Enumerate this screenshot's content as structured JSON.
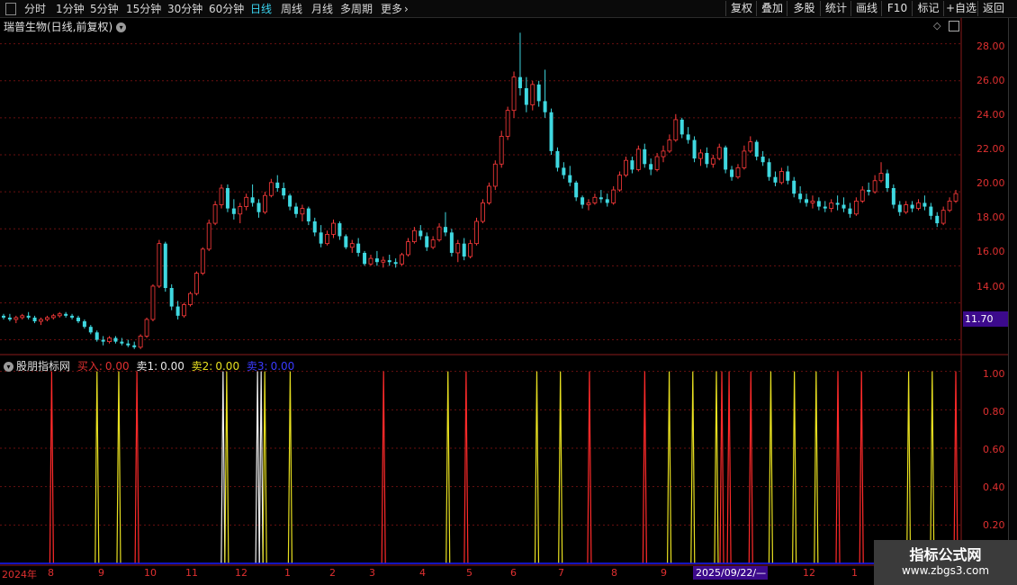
{
  "toolbar": {
    "periods": [
      "分时",
      "1分钟",
      "5分钟",
      "15分钟",
      "30分钟",
      "60分钟",
      "日线",
      "周线",
      "月线",
      "多周期",
      "更多"
    ],
    "active_period": "日线",
    "more_arrow": "›",
    "right_buttons": [
      "复权",
      "叠加",
      "多股",
      "统计",
      "画线",
      "F10",
      "标记",
      "+自选",
      "返回"
    ]
  },
  "main": {
    "title": "瑞普生物(日线,前复权)",
    "price_ticks": [
      "28.00",
      "26.00",
      "24.00",
      "22.00",
      "20.00",
      "18.00",
      "16.00",
      "14.00"
    ],
    "current_price": "11.70"
  },
  "indicator": {
    "name": "股朋指标网",
    "buy_label": "买入:",
    "buy_value": "0.00",
    "sell1_label": "卖1:",
    "sell1_value": "0.00",
    "sell2_label": "卖2:",
    "sell2_value": "0.00",
    "sell3_label": "卖3:",
    "sell3_value": "0.00",
    "ticks": [
      "1.00",
      "0.80",
      "0.60",
      "0.40",
      "0.20"
    ]
  },
  "date_axis": {
    "labels": [
      "2024年",
      "8",
      "9",
      "10",
      "11",
      "12",
      "1",
      "2",
      "3",
      "4",
      "5",
      "6",
      "7",
      "8",
      "9",
      "12",
      "1"
    ],
    "highlight": "2025/09/22/—"
  },
  "watermark": {
    "title": "指标公式网",
    "url": "www.zbgs3.com"
  },
  "chart_data": {
    "type": "candlestick",
    "ylim": [
      11.2,
      29.2
    ],
    "candles": [
      [
        13.3,
        13.4,
        13.1,
        13.2
      ],
      [
        13.2,
        13.4,
        13.0,
        13.1
      ],
      [
        13.1,
        13.3,
        12.9,
        13.2
      ],
      [
        13.2,
        13.4,
        13.1,
        13.3
      ],
      [
        13.3,
        13.5,
        13.1,
        13.2
      ],
      [
        13.2,
        13.3,
        12.9,
        13.0
      ],
      [
        13.0,
        13.2,
        12.8,
        13.1
      ],
      [
        13.1,
        13.3,
        13.0,
        13.2
      ],
      [
        13.2,
        13.4,
        13.1,
        13.3
      ],
      [
        13.3,
        13.5,
        13.2,
        13.4
      ],
      [
        13.4,
        13.5,
        13.2,
        13.3
      ],
      [
        13.3,
        13.4,
        13.1,
        13.2
      ],
      [
        13.2,
        13.3,
        12.9,
        13.0
      ],
      [
        13.0,
        13.1,
        12.6,
        12.7
      ],
      [
        12.7,
        12.8,
        12.3,
        12.4
      ],
      [
        12.4,
        12.5,
        11.9,
        12.0
      ],
      [
        12.0,
        12.2,
        11.7,
        11.9
      ],
      [
        11.9,
        12.2,
        11.8,
        12.1
      ],
      [
        12.1,
        12.2,
        11.8,
        11.9
      ],
      [
        11.9,
        12.1,
        11.7,
        11.8
      ],
      [
        11.8,
        12.0,
        11.6,
        11.7
      ],
      [
        11.7,
        11.9,
        11.5,
        11.6
      ],
      [
        11.6,
        12.3,
        11.5,
        12.2
      ],
      [
        12.2,
        13.2,
        12.1,
        13.1
      ],
      [
        13.1,
        15.0,
        13.0,
        14.9
      ],
      [
        14.9,
        17.4,
        14.8,
        17.2
      ],
      [
        17.2,
        17.3,
        14.6,
        14.8
      ],
      [
        14.8,
        15.0,
        13.6,
        13.8
      ],
      [
        13.8,
        14.1,
        13.1,
        13.3
      ],
      [
        13.3,
        14.0,
        13.2,
        13.9
      ],
      [
        13.9,
        14.6,
        13.8,
        14.5
      ],
      [
        14.5,
        15.7,
        14.4,
        15.6
      ],
      [
        15.6,
        17.0,
        15.5,
        16.9
      ],
      [
        16.9,
        18.5,
        16.8,
        18.3
      ],
      [
        18.3,
        19.5,
        18.2,
        19.3
      ],
      [
        19.3,
        20.4,
        19.1,
        20.2
      ],
      [
        20.2,
        20.4,
        18.9,
        19.1
      ],
      [
        19.1,
        19.6,
        18.5,
        18.8
      ],
      [
        18.8,
        19.4,
        18.3,
        19.2
      ],
      [
        19.2,
        19.9,
        19.0,
        19.7
      ],
      [
        19.7,
        20.4,
        19.2,
        19.4
      ],
      [
        19.4,
        19.6,
        18.6,
        18.9
      ],
      [
        18.9,
        20.0,
        18.8,
        19.8
      ],
      [
        19.8,
        20.7,
        19.7,
        20.5
      ],
      [
        20.5,
        20.9,
        20.0,
        20.2
      ],
      [
        20.2,
        20.5,
        19.6,
        19.8
      ],
      [
        19.8,
        19.9,
        19.0,
        19.2
      ],
      [
        19.2,
        19.4,
        18.6,
        18.8
      ],
      [
        18.8,
        19.3,
        18.4,
        19.1
      ],
      [
        19.1,
        19.2,
        18.2,
        18.4
      ],
      [
        18.4,
        18.6,
        17.6,
        17.8
      ],
      [
        17.8,
        18.2,
        17.0,
        17.2
      ],
      [
        17.2,
        17.9,
        17.1,
        17.7
      ],
      [
        17.7,
        18.5,
        17.5,
        18.3
      ],
      [
        18.3,
        18.4,
        17.4,
        17.6
      ],
      [
        17.6,
        17.7,
        16.9,
        17.0
      ],
      [
        17.0,
        17.4,
        16.7,
        17.2
      ],
      [
        17.2,
        17.5,
        16.5,
        16.7
      ],
      [
        16.7,
        16.8,
        16.0,
        16.1
      ],
      [
        16.1,
        16.6,
        16.0,
        16.4
      ],
      [
        16.4,
        16.8,
        16.0,
        16.2
      ],
      [
        16.2,
        16.5,
        15.9,
        16.3
      ],
      [
        16.3,
        16.6,
        16.0,
        16.2
      ],
      [
        16.2,
        16.4,
        15.9,
        16.1
      ],
      [
        16.1,
        16.7,
        16.0,
        16.6
      ],
      [
        16.6,
        17.5,
        16.5,
        17.3
      ],
      [
        17.3,
        18.1,
        17.2,
        17.9
      ],
      [
        17.9,
        18.2,
        17.4,
        17.6
      ],
      [
        17.6,
        17.8,
        16.8,
        17.0
      ],
      [
        17.0,
        17.6,
        16.9,
        17.4
      ],
      [
        17.4,
        18.3,
        17.3,
        18.1
      ],
      [
        18.1,
        18.9,
        17.6,
        17.8
      ],
      [
        17.8,
        18.0,
        16.5,
        16.7
      ],
      [
        16.7,
        17.4,
        16.2,
        17.2
      ],
      [
        17.2,
        17.5,
        16.3,
        16.5
      ],
      [
        16.5,
        17.4,
        16.4,
        17.2
      ],
      [
        17.2,
        18.6,
        17.1,
        18.4
      ],
      [
        18.4,
        19.6,
        18.3,
        19.4
      ],
      [
        19.4,
        20.5,
        19.3,
        20.3
      ],
      [
        20.3,
        21.7,
        20.1,
        21.5
      ],
      [
        21.5,
        23.3,
        21.3,
        23.0
      ],
      [
        23.0,
        24.6,
        22.8,
        24.4
      ],
      [
        24.4,
        26.5,
        24.0,
        26.2
      ],
      [
        26.2,
        28.6,
        25.2,
        25.6
      ],
      [
        25.6,
        26.2,
        24.3,
        24.7
      ],
      [
        24.7,
        26.0,
        24.4,
        25.8
      ],
      [
        25.8,
        26.0,
        24.6,
        24.9
      ],
      [
        24.9,
        26.6,
        24.0,
        24.3
      ],
      [
        24.3,
        24.5,
        22.0,
        22.2
      ],
      [
        22.2,
        22.4,
        21.1,
        21.3
      ],
      [
        21.3,
        21.6,
        20.7,
        20.9
      ],
      [
        20.9,
        21.4,
        20.3,
        20.5
      ],
      [
        20.5,
        20.6,
        19.5,
        19.7
      ],
      [
        19.7,
        19.8,
        19.1,
        19.3
      ],
      [
        19.3,
        19.6,
        19.0,
        19.4
      ],
      [
        19.4,
        19.9,
        19.3,
        19.7
      ],
      [
        19.7,
        20.1,
        19.4,
        19.6
      ],
      [
        19.6,
        19.9,
        19.2,
        19.4
      ],
      [
        19.4,
        20.3,
        19.3,
        20.1
      ],
      [
        20.1,
        21.1,
        20.0,
        20.9
      ],
      [
        20.9,
        21.9,
        20.8,
        21.7
      ],
      [
        21.7,
        21.9,
        21.0,
        21.2
      ],
      [
        21.2,
        22.5,
        21.1,
        22.3
      ],
      [
        22.3,
        22.6,
        21.3,
        21.5
      ],
      [
        21.5,
        21.8,
        20.9,
        21.2
      ],
      [
        21.2,
        22.1,
        21.1,
        21.9
      ],
      [
        21.9,
        22.5,
        21.6,
        22.2
      ],
      [
        22.2,
        23.1,
        22.1,
        22.8
      ],
      [
        22.8,
        24.2,
        22.7,
        23.9
      ],
      [
        23.9,
        24.0,
        22.9,
        23.1
      ],
      [
        23.1,
        23.5,
        22.6,
        22.8
      ],
      [
        22.8,
        23.0,
        21.6,
        21.8
      ],
      [
        21.8,
        22.3,
        21.4,
        22.1
      ],
      [
        22.1,
        22.4,
        21.3,
        21.5
      ],
      [
        21.5,
        22.0,
        21.3,
        21.8
      ],
      [
        21.8,
        22.6,
        21.7,
        22.4
      ],
      [
        22.4,
        22.5,
        21.0,
        21.2
      ],
      [
        21.2,
        21.4,
        20.6,
        20.8
      ],
      [
        20.8,
        21.5,
        20.7,
        21.3
      ],
      [
        21.3,
        22.5,
        21.2,
        22.2
      ],
      [
        22.2,
        23.0,
        22.1,
        22.7
      ],
      [
        22.7,
        22.8,
        21.7,
        21.9
      ],
      [
        21.9,
        22.2,
        21.4,
        21.6
      ],
      [
        21.6,
        21.8,
        20.6,
        20.8
      ],
      [
        20.8,
        21.1,
        20.3,
        20.5
      ],
      [
        20.5,
        21.3,
        20.4,
        21.1
      ],
      [
        21.1,
        21.4,
        20.4,
        20.6
      ],
      [
        20.6,
        20.8,
        19.7,
        19.9
      ],
      [
        19.9,
        20.3,
        19.4,
        19.6
      ],
      [
        19.6,
        19.9,
        19.2,
        19.4
      ],
      [
        19.4,
        19.8,
        19.1,
        19.5
      ],
      [
        19.5,
        19.7,
        19.0,
        19.2
      ],
      [
        19.2,
        19.5,
        18.9,
        19.1
      ],
      [
        19.1,
        19.6,
        18.9,
        19.4
      ],
      [
        19.4,
        19.8,
        19.0,
        19.3
      ],
      [
        19.3,
        19.7,
        18.9,
        19.1
      ],
      [
        19.1,
        19.4,
        18.6,
        18.8
      ],
      [
        18.8,
        19.7,
        18.7,
        19.5
      ],
      [
        19.5,
        20.3,
        19.4,
        20.1
      ],
      [
        20.1,
        20.5,
        19.8,
        20.0
      ],
      [
        20.0,
        20.9,
        19.9,
        20.6
      ],
      [
        20.6,
        21.6,
        20.5,
        21.0
      ],
      [
        21.0,
        21.2,
        20.0,
        20.2
      ],
      [
        20.2,
        20.4,
        19.1,
        19.3
      ],
      [
        19.3,
        19.5,
        18.7,
        18.9
      ],
      [
        18.9,
        19.5,
        18.8,
        19.3
      ],
      [
        19.3,
        19.5,
        18.9,
        19.1
      ],
      [
        19.1,
        19.6,
        19.0,
        19.4
      ],
      [
        19.4,
        19.8,
        19.0,
        19.2
      ],
      [
        19.2,
        19.4,
        18.5,
        18.7
      ],
      [
        18.7,
        18.9,
        18.1,
        18.3
      ],
      [
        18.3,
        19.2,
        18.2,
        19.0
      ],
      [
        19.0,
        19.7,
        18.9,
        19.5
      ],
      [
        19.5,
        20.1,
        19.4,
        19.9
      ]
    ],
    "indicator": {
      "ylim": [
        0,
        1.05
      ],
      "spikes": [
        {
          "pos": 0.053,
          "color": "red"
        },
        {
          "pos": 0.103,
          "color": "yellow"
        },
        {
          "pos": 0.127,
          "color": "yellow"
        },
        {
          "pos": 0.147,
          "color": "red"
        },
        {
          "pos": 0.242,
          "color": "white"
        },
        {
          "pos": 0.246,
          "color": "yellow"
        },
        {
          "pos": 0.28,
          "color": "white"
        },
        {
          "pos": 0.284,
          "color": "white"
        },
        {
          "pos": 0.288,
          "color": "yellow"
        },
        {
          "pos": 0.316,
          "color": "yellow"
        },
        {
          "pos": 0.419,
          "color": "red"
        },
        {
          "pos": 0.49,
          "color": "yellow"
        },
        {
          "pos": 0.51,
          "color": "red"
        },
        {
          "pos": 0.588,
          "color": "yellow"
        },
        {
          "pos": 0.614,
          "color": "yellow"
        },
        {
          "pos": 0.646,
          "color": "red"
        },
        {
          "pos": 0.707,
          "color": "red"
        },
        {
          "pos": 0.734,
          "color": "yellow"
        },
        {
          "pos": 0.76,
          "color": "yellow"
        },
        {
          "pos": 0.786,
          "color": "yellow"
        },
        {
          "pos": 0.792,
          "color": "red"
        },
        {
          "pos": 0.8,
          "color": "red"
        },
        {
          "pos": 0.824,
          "color": "red"
        },
        {
          "pos": 0.846,
          "color": "yellow"
        },
        {
          "pos": 0.872,
          "color": "yellow"
        },
        {
          "pos": 0.896,
          "color": "yellow"
        },
        {
          "pos": 0.92,
          "color": "red"
        },
        {
          "pos": 0.946,
          "color": "red"
        },
        {
          "pos": 0.998,
          "color": "yellow"
        },
        {
          "pos": 1.024,
          "color": "yellow"
        },
        {
          "pos": 1.05,
          "color": "red"
        }
      ]
    }
  }
}
